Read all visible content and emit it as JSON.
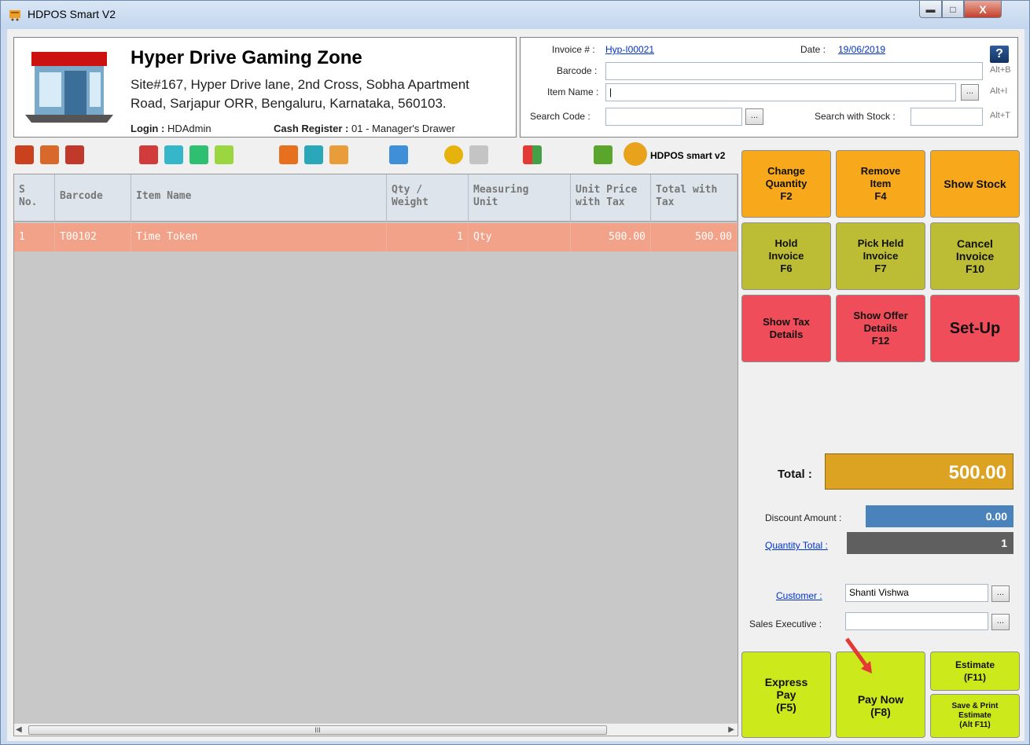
{
  "window": {
    "title": "HDPOS Smart V2"
  },
  "store": {
    "name": "Hyper Drive Gaming Zone",
    "address_line1": "Site#167, Hyper Drive lane, 2nd Cross, Sobha Apartment",
    "address_line2": "Road, Sarjapur ORR, Bengaluru, Karnataka, 560103.",
    "login_label": "Login :",
    "login_value": "HDAdmin",
    "cash_register_label": "Cash Register :",
    "cash_register_value": "01 - Manager's Drawer"
  },
  "invoice": {
    "invoice_label": "Invoice # :",
    "invoice_value": "Hyp-I00021",
    "date_label": "Date :",
    "date_value": "19/06/2019",
    "help": "?",
    "barcode_label": "Barcode :",
    "barcode_value": "",
    "barcode_shortcut": "Alt+B",
    "item_name_label": "Item Name :",
    "item_name_value": "|",
    "item_name_shortcut": "Alt+I",
    "search_code_label": "Search Code :",
    "search_code_value": "",
    "search_stock_label": "Search with Stock :",
    "search_stock_value": "",
    "search_stock_shortcut": "Alt+T",
    "browse": "..."
  },
  "toolbar": {
    "label": "HDPOS smart v2"
  },
  "grid": {
    "columns": [
      "S\nNo.",
      "Barcode",
      "Item Name",
      "Qty /\nWeight",
      "Measuring\nUnit",
      "Unit Price\nwith Tax",
      "Total with\nTax"
    ],
    "rows": [
      {
        "sno": "1",
        "barcode": "T00102",
        "item": "Time Token",
        "qty": "1",
        "unit": "Qty",
        "unit_price": "500.00",
        "total": "500.00"
      }
    ],
    "scroll_thumb": "III"
  },
  "actions": {
    "change_qty": "Change\nQuantity\nF2",
    "remove_item": "Remove\nItem\nF4",
    "show_stock": "Show Stock",
    "hold_invoice": "Hold\nInvoice\nF6",
    "pick_held": "Pick Held\nInvoice\nF7",
    "cancel_invoice": "Cancel\nInvoice\nF10",
    "show_tax": "Show Tax\nDetails",
    "show_offer": "Show Offer\nDetails\nF12",
    "setup": "Set-Up",
    "express_pay": "Express\nPay\n(F5)",
    "pay_now": "Pay Now\n(F8)",
    "estimate": "Estimate\n(F11)",
    "save_print_estimate": "Save & Print\nEstimate\n(Alt F11)"
  },
  "totals": {
    "total_label": "Total :",
    "total_value": "500.00",
    "discount_label": "Discount Amount :",
    "discount_value": "0.00",
    "qty_total_label": "Quantity Total :",
    "qty_total_value": "1"
  },
  "customer": {
    "customer_label": "Customer :",
    "customer_value": "Shanti Vishwa",
    "sales_exec_label": "Sales Executive :",
    "sales_exec_value": ""
  },
  "colors": {
    "orange": "#f7a81b",
    "olive": "#bcbd35",
    "red": "#ee4d59",
    "lime": "#ccea1b",
    "row_highlight": "#f2a288",
    "total": "#dca322",
    "discount": "#4a82bc"
  }
}
